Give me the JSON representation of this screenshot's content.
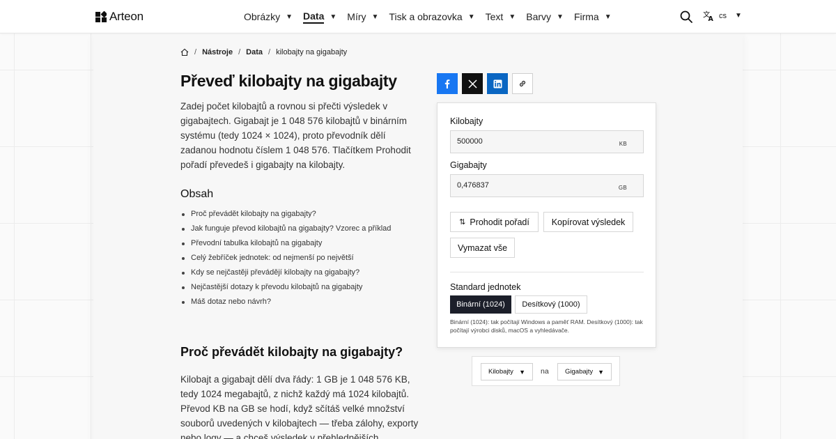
{
  "brand": {
    "name": "Arteon"
  },
  "nav": {
    "items": [
      {
        "label": "Obrázky",
        "active": false
      },
      {
        "label": "Data",
        "active": true
      },
      {
        "label": "Míry",
        "active": false
      },
      {
        "label": "Tisk a obrazovka",
        "active": false
      },
      {
        "label": "Text",
        "active": false
      },
      {
        "label": "Barvy",
        "active": false
      },
      {
        "label": "Firma",
        "active": false
      }
    ],
    "lang_code": "cs"
  },
  "breadcrumb": {
    "items": [
      "Nástroje",
      "Data",
      "kilobajty na gigabajty"
    ]
  },
  "page": {
    "title": "Převeď kilobajty na gigabajty",
    "intro": "Zadej počet kilobajtů a rovnou si přečti výsledek v gigabajtech. Gigabajt je 1 048 576 kilobajtů v binárním systému (tedy 1024 × 1024), proto převodník dělí zadanou hodnotu číslem 1 048 576. Tlačítkem Prohodit pořadí převedeš i gigabajty na kilobajty."
  },
  "toc": {
    "title": "Obsah",
    "items": [
      "Proč převádět kilobajty na gigabajty?",
      "Jak funguje převod kilobajtů na gigabajty? Vzorec a příklad",
      "Převodní tabulka kilobajtů na gigabajty",
      "Celý žebříček jednotek: od nejmenší po největší",
      "Kdy se nejčastěji převádějí kilobajty na gigabajty?",
      "Nejčastější dotazy k převodu kilobajtů na gigabajty",
      "Máš dotaz nebo návrh?"
    ]
  },
  "section": {
    "title": "Proč převádět kilobajty na gigabajty?",
    "body": "Kilobajt a gigabajt dělí dva řády: 1 GB je 1 048 576 KB, tedy 1024 megabajtů, z nichž každý má 1024 kilobajtů. Převod KB na GB se hodí, když sčítáš velké množství souborů uvedených v kilobajtech — třeba zálohy, exporty nebo logy — a chceš výsledek v přehlednějších gigabajtech."
  },
  "converter": {
    "from": {
      "label": "Kilobajty",
      "value": "500000",
      "unit": "KB"
    },
    "to": {
      "label": "Gigabajty",
      "value": "0,476837",
      "unit": "GB"
    },
    "swap_label": "Prohodit pořadí",
    "copy_label": "Kopírovat výsledek",
    "clear_label": "Vymazat vše",
    "standard": {
      "label": "Standard jednotek",
      "options": [
        "Binární (1024)",
        "Desítkový (1000)"
      ],
      "selected": "Binární (1024)",
      "note": "Binární (1024): tak počítají Windows a paměť RAM. Desítkový (1000): tak počítají výrobci disků, macOS a vyhledávače."
    }
  },
  "unit_picker": {
    "from_unit": "Kilobajty",
    "connector": "na",
    "to_unit": "Gigabajty"
  }
}
